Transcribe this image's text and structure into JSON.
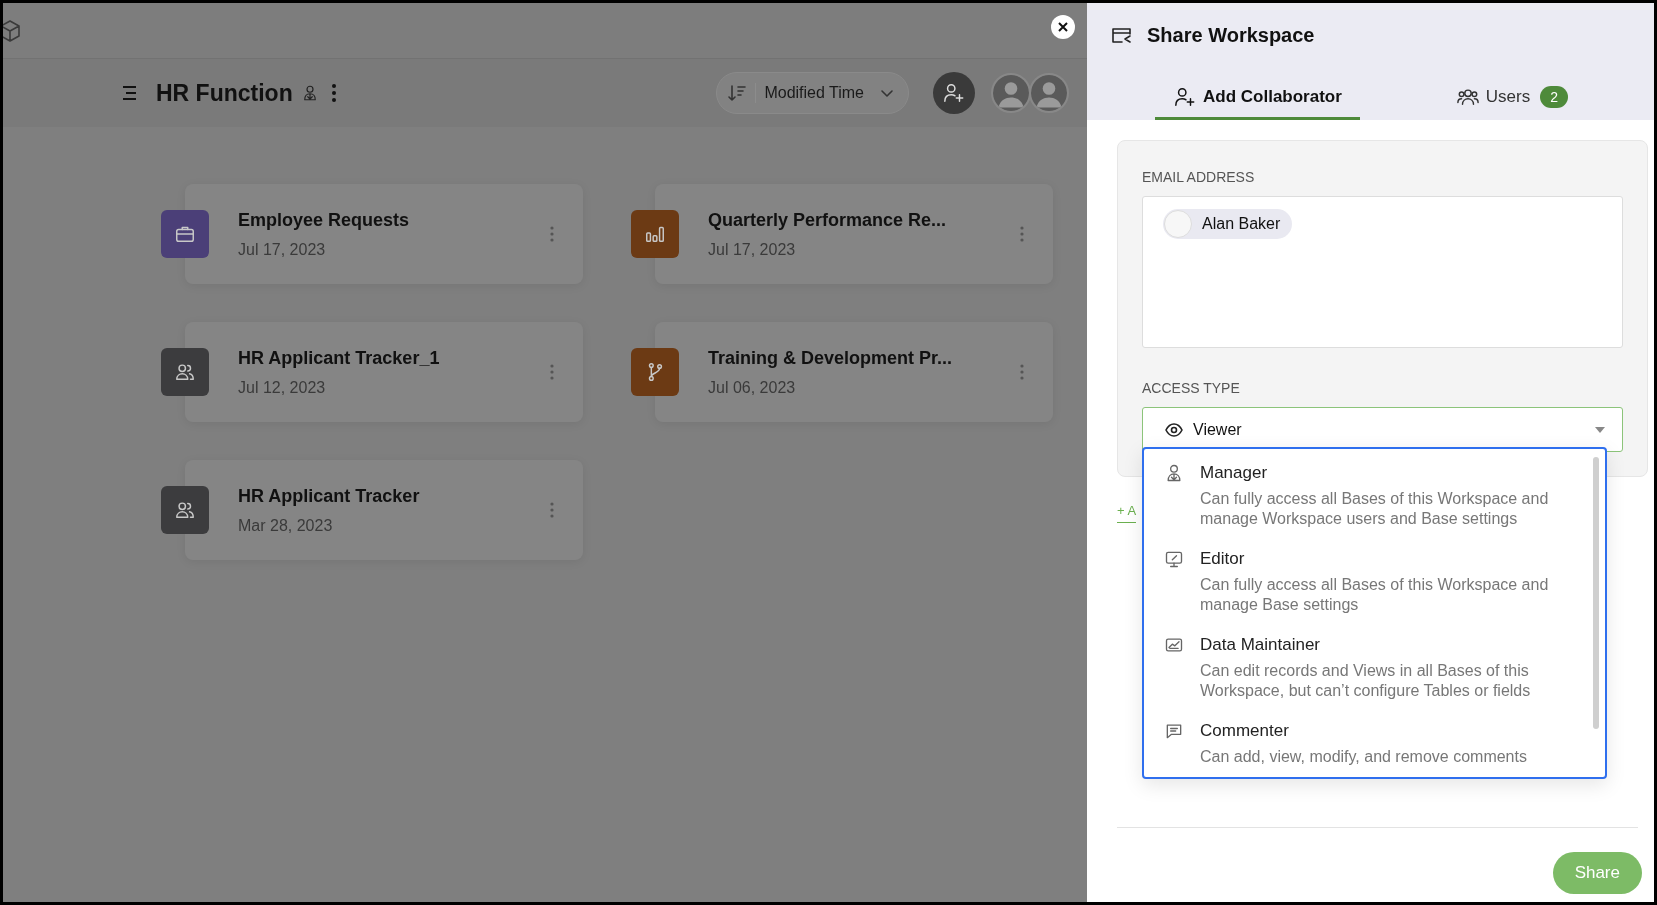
{
  "page": {
    "title": "HR Function",
    "sort": {
      "label": "Modified Time"
    },
    "cards": [
      {
        "title": "Employee Requests",
        "date": "Jul 17, 2023",
        "kind": "briefcase",
        "color": "#4b3f78"
      },
      {
        "title": "Quarterly Performance Re...",
        "date": "Jul 17, 2023",
        "kind": "chart",
        "color": "#6c3a14"
      },
      {
        "title": "HR Applicant Tracker_1",
        "date": "Jul 12, 2023",
        "kind": "people",
        "color": "#3c3c3e"
      },
      {
        "title": "Training & Development Pr...",
        "date": "Jul 06, 2023",
        "kind": "branch",
        "color": "#6c3a14"
      },
      {
        "title": "HR Applicant Tracker",
        "date": "Mar 28, 2023",
        "kind": "people",
        "color": "#3c3c3e"
      }
    ]
  },
  "panel": {
    "title": "Share Workspace",
    "tabs": [
      {
        "label": "Add Collaborator",
        "kind": "add",
        "selected": true
      },
      {
        "label": "Users",
        "kind": "users",
        "badge": "2",
        "selected": false
      }
    ],
    "email": {
      "label": "EMAIL ADDRESS",
      "chips": [
        "Alan Baker"
      ]
    },
    "access": {
      "label": "ACCESS TYPE",
      "value": "Viewer",
      "options": [
        {
          "kind": "manager",
          "title": "Manager",
          "description": "Can fully access all Bases of this Workspace and manage Workspace users and Base settings"
        },
        {
          "kind": "editor",
          "title": "Editor",
          "description": "Can fully access all Bases of this Workspace and manage Base settings"
        },
        {
          "kind": "maintainer",
          "title": "Data Maintainer",
          "description": "Can edit records and Views in all Bases of this Workspace, but can’t configure Tables or fields"
        },
        {
          "kind": "commenter",
          "title": "Commenter",
          "description": "Can add, view, modify, and remove comments"
        }
      ]
    },
    "add_link": "+ A",
    "share_button": "Share"
  }
}
